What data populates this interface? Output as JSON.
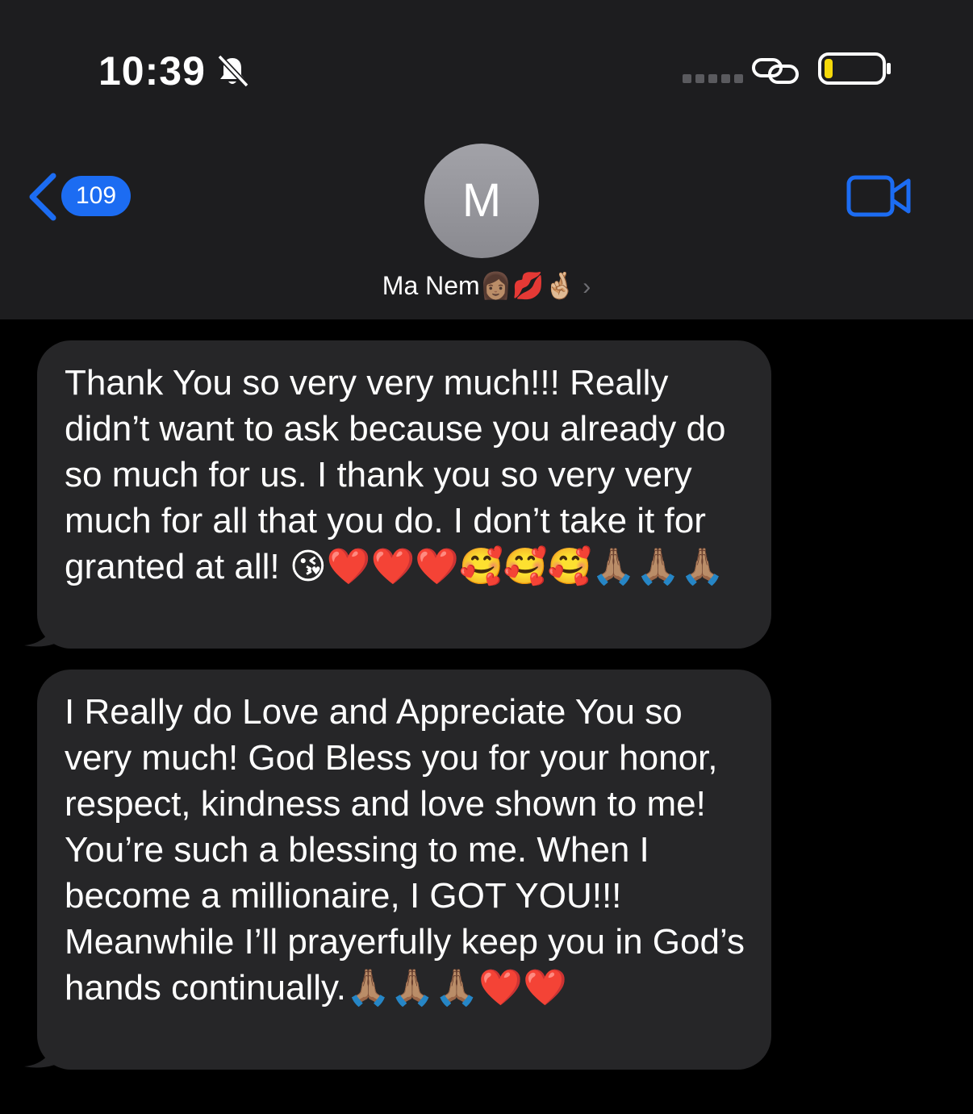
{
  "status_bar": {
    "time": "10:39",
    "icons": [
      "bell-slash-icon",
      "signal-dots-icon",
      "link-icon",
      "battery-icon"
    ],
    "battery_level": 0.1
  },
  "nav": {
    "back_badge": "109",
    "avatar_initial": "M",
    "contact_name": "Ma Nem👩🏽💋🤞🏼",
    "contact_chevron": "›",
    "right_icon": "video-camera-icon"
  },
  "messages": [
    {
      "text": "Thank You so very very much!!! Really didn’t want to ask because you already do so much for us. I thank you so very very much for all that you do. I don’t take it for granted at all! 😘❤️❤️❤️🥰🥰🥰🙏🏽🙏🏽🙏🏽"
    },
    {
      "text": "I Really do Love and Appreciate You so very much! God Bless you for your honor, respect, kindness and love shown to me! You’re such a blessing to me. When I become a millionaire, I GOT YOU!!! Meanwhile I’ll prayerfully keep you in God’s hands continually.🙏🏽🙏🏽🙏🏽❤️❤️"
    }
  ],
  "colors": {
    "header_bg": "#1d1d1f",
    "bubble_bg": "#262628",
    "accent_blue": "#1c6cf2",
    "battery_yellow": "#f5d90a"
  }
}
